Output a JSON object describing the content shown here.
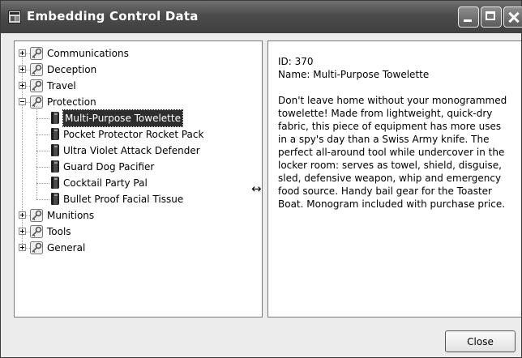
{
  "window": {
    "title": "Embedding Control Data"
  },
  "tree": {
    "items": [
      {
        "label": "Communications",
        "expanded": false,
        "icon": "key-icon"
      },
      {
        "label": "Deception",
        "expanded": false,
        "icon": "key-icon"
      },
      {
        "label": "Travel",
        "expanded": false,
        "icon": "key-icon"
      },
      {
        "label": "Protection",
        "expanded": true,
        "icon": "key-icon",
        "children": [
          {
            "label": "Multi-Purpose Towelette",
            "selected": true,
            "icon": "book-icon"
          },
          {
            "label": "Pocket Protector Rocket Pack",
            "icon": "book-icon"
          },
          {
            "label": "Ultra Violet Attack Defender",
            "icon": "book-icon"
          },
          {
            "label": "Guard Dog Pacifier",
            "icon": "book-icon"
          },
          {
            "label": "Cocktail Party Pal",
            "icon": "book-icon"
          },
          {
            "label": "Bullet Proof Facial Tissue",
            "icon": "book-icon"
          }
        ]
      },
      {
        "label": "Munitions",
        "expanded": false,
        "icon": "key-icon"
      },
      {
        "label": "Tools",
        "expanded": false,
        "icon": "key-icon"
      },
      {
        "label": "General",
        "expanded": false,
        "icon": "key-icon"
      }
    ]
  },
  "detail": {
    "id_line": "ID: 370",
    "name_line": "Name: Multi-Purpose Towelette",
    "description": "Don't leave home without your monogrammed towelette! Made from lightweight, quick-dry fabric, this piece of equipment has more uses in a spy's day than a Swiss Army knife. The perfect all-around tool while undercover in the locker room: serves as towel, shield, disguise, sled, defensive weapon, whip and emergency food source. Handy bail gear for the Toaster Boat. Monogram included with purchase price."
  },
  "buttons": {
    "close_label": "Close"
  }
}
